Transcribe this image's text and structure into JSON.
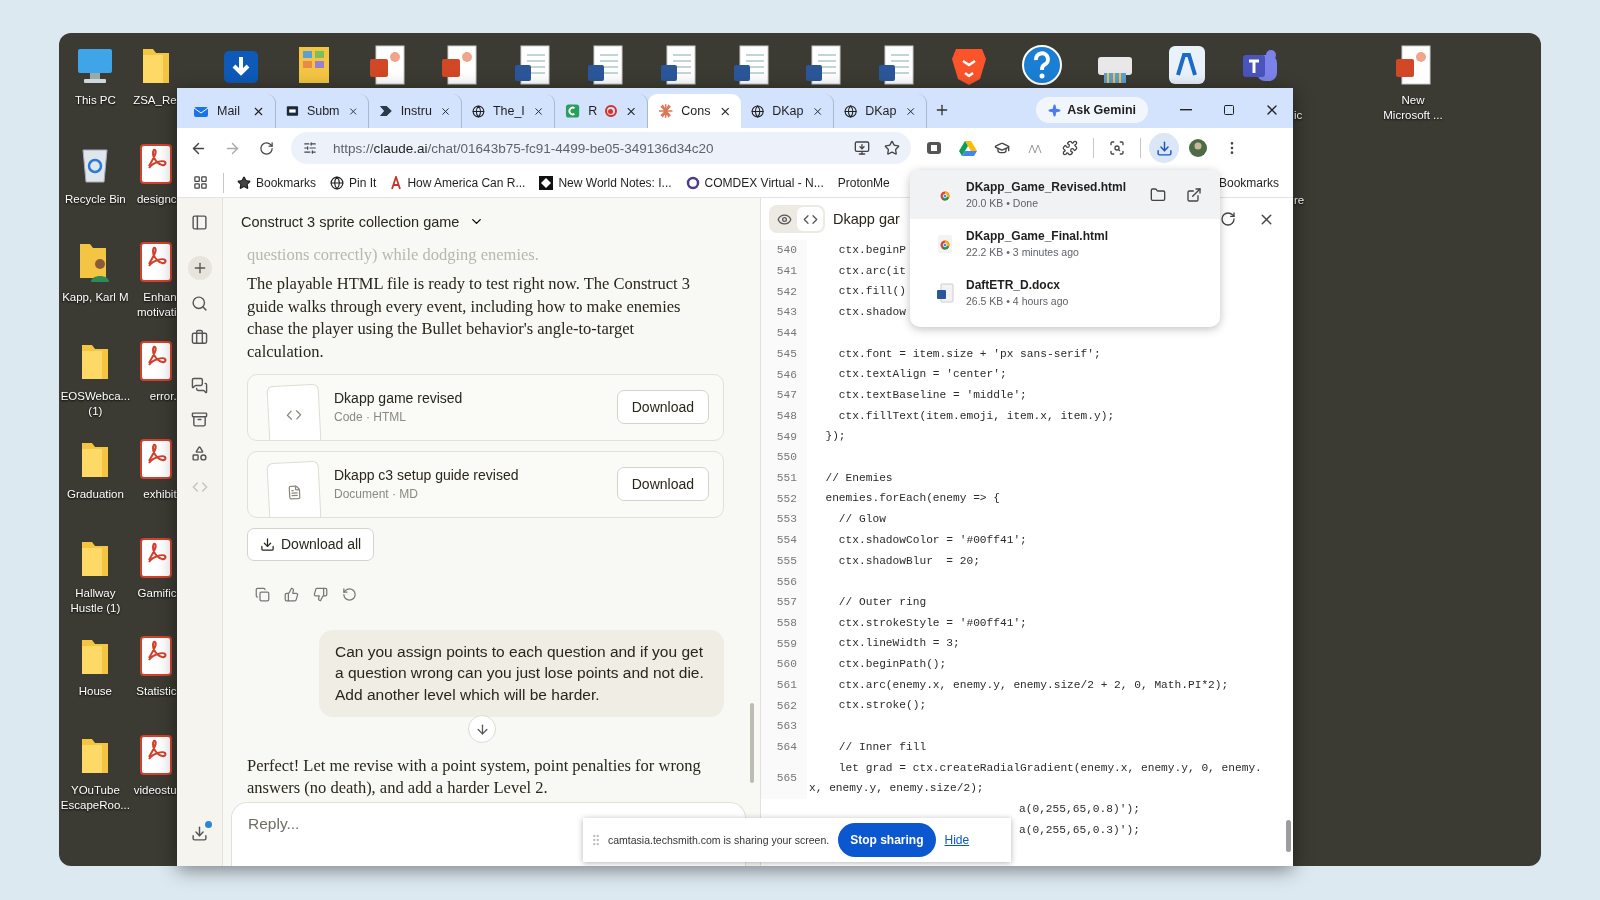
{
  "desktop": {
    "columns": [
      [
        {
          "kind": "pc",
          "label": "This PC"
        },
        {
          "kind": "recycle",
          "label": "Recycle Bin"
        },
        {
          "kind": "person-folder",
          "label": "Kapp, Karl M"
        },
        {
          "kind": "folder",
          "label": "EOSWebca... (1)"
        },
        {
          "kind": "folder",
          "label": "Graduation"
        },
        {
          "kind": "folder",
          "label": "Hallway Hustle (1)"
        },
        {
          "kind": "folder",
          "label": "House"
        },
        {
          "kind": "folder",
          "label": "YOuTube EscapeRoo..."
        }
      ],
      [
        {
          "kind": "folder",
          "label": "ZSA_Re"
        },
        {
          "kind": "pdf",
          "label": "designc"
        },
        {
          "kind": "pdf",
          "label": "Enhan motivati"
        },
        {
          "kind": "pdf",
          "label": "error."
        },
        {
          "kind": "pdf",
          "label": "exhibit"
        },
        {
          "kind": "pdf",
          "label": "Gamific"
        },
        {
          "kind": "pdf",
          "label": "Statistic"
        },
        {
          "kind": "pdf",
          "label": "videostu"
        }
      ],
      [
        {
          "kind": "store"
        }
      ],
      [
        {
          "kind": "photos"
        }
      ],
      [
        {
          "kind": "ppt"
        }
      ],
      [
        {
          "kind": "ppt"
        }
      ],
      [
        {
          "kind": "word"
        }
      ],
      [
        {
          "kind": "word"
        }
      ],
      [
        {
          "kind": "word"
        }
      ],
      [
        {
          "kind": "word"
        }
      ],
      [
        {
          "kind": "word"
        }
      ],
      [
        {
          "kind": "word"
        }
      ],
      [
        {
          "kind": "brave"
        }
      ],
      [
        {
          "kind": "help"
        }
      ],
      [
        {
          "kind": "printer"
        }
      ],
      [
        {
          "kind": "acrobat"
        }
      ],
      [
        {
          "kind": "teams"
        }
      ]
    ],
    "label_fragments": [
      "ic",
      "re"
    ],
    "right_icons": [
      {
        "kind": "ppt",
        "label": "New Microsoft ..."
      }
    ]
  },
  "browser": {
    "tabs": [
      {
        "label": "Mail",
        "kind": "mail",
        "recording": false,
        "selected": false
      },
      {
        "label": "Subm",
        "kind": "sn",
        "recording": false,
        "selected": false
      },
      {
        "label": "Instru",
        "kind": "arrow",
        "recording": false,
        "selected": false
      },
      {
        "label": "The_I",
        "kind": "globe",
        "recording": false,
        "selected": false
      },
      {
        "label": "R",
        "kind": "sheet",
        "recording": true,
        "selected": false
      },
      {
        "label": "Cons",
        "kind": "claude",
        "recording": false,
        "selected": true
      },
      {
        "label": "DKap",
        "kind": "globe",
        "recording": false,
        "selected": false
      },
      {
        "label": "DKap",
        "kind": "globe",
        "recording": false,
        "selected": false
      }
    ],
    "gemini_button": "Ask Gemini",
    "url": {
      "scheme": "https://",
      "host": "claude.ai",
      "path": "/chat/01643b75-fc91-4499-be05-349136d34c20"
    },
    "bookmarks": [
      {
        "label": "Bookmarks",
        "kind": "star"
      },
      {
        "label": "Pin It",
        "kind": "globe"
      },
      {
        "label": "How America Can R...",
        "kind": "letter"
      },
      {
        "label": "New World Notes: I...",
        "kind": "square"
      },
      {
        "label": "COMDEX Virtual - N...",
        "kind": "ring"
      },
      {
        "label": "ProtonMe",
        "kind": "none"
      }
    ],
    "all_bookmarks": "Bookmarks",
    "downloads": [
      {
        "name": "DKapp_Game_Revised.html",
        "meta": "20.0 KB • Done",
        "kind": "web",
        "selected": true
      },
      {
        "name": "DKapp_Game_Final.html",
        "meta": "22.2 KB • 3 minutes ago",
        "kind": "web",
        "selected": false
      },
      {
        "name": "DaftETR_D.docx",
        "meta": "26.5 KB • 4 hours ago",
        "kind": "word",
        "selected": false
      }
    ]
  },
  "chat": {
    "title": "Construct 3 sprite collection game",
    "faded_text": "questions correctly) while dodging enemies.",
    "paragraph": "The playable HTML file is ready to test right now. The Construct 3 guide walks through every event, including how to make enemies chase the player using the Bullet behavior's angle-to-target calculation.",
    "files": [
      {
        "title": "Dkapp game revised",
        "meta": "Code · HTML",
        "kind": "code",
        "button": "Download"
      },
      {
        "title": "Dkapp c3 setup guide revised",
        "meta": "Document · MD",
        "kind": "doc",
        "button": "Download"
      }
    ],
    "download_all": "Download all",
    "user_message": "Can you assign points to each question and if you get a question wrong can you just lose points and not die. Add another level which will be harder.",
    "response": "Perfect! Let me revise with a point system, point penalties for wrong answers (no death), and add a harder Level 2.",
    "reply_placeholder": "Reply..."
  },
  "artifact": {
    "title": "Dkapp gar",
    "view_toggle": [
      {
        "kind": "eye",
        "selected": false
      },
      {
        "kind": "code",
        "selected": true
      }
    ],
    "lines": [
      {
        "kind": "code",
        "number": "540",
        "text": "    ctx.beginP"
      },
      {
        "kind": "code",
        "number": "541",
        "text": "    ctx.arc(it"
      },
      {
        "kind": "code",
        "number": "542",
        "text": "    ctx.fill()"
      },
      {
        "kind": "code",
        "number": "543",
        "text": "    ctx.shadow"
      },
      {
        "kind": "code",
        "number": "544"
      },
      {
        "kind": "code",
        "number": "545",
        "text": "    ctx.font = item.size + 'px sans-serif';"
      },
      {
        "kind": "code",
        "number": "546",
        "text": "    ctx.textAlign = 'center';"
      },
      {
        "kind": "code",
        "number": "547",
        "text": "    ctx.textBaseline = 'middle';"
      },
      {
        "kind": "code",
        "number": "548",
        "text": "    ctx.fillText(item.emoji, item.x, item.y);"
      },
      {
        "kind": "code",
        "number": "549",
        "text": "  });"
      },
      {
        "kind": "code",
        "number": "550"
      },
      {
        "kind": "code",
        "number": "551",
        "text": "  // Enemies"
      },
      {
        "kind": "code",
        "number": "552",
        "text": "  enemies.forEach(enemy => {"
      },
      {
        "kind": "code",
        "number": "553",
        "text": "    // Glow"
      },
      {
        "kind": "code",
        "number": "554",
        "text": "    ctx.shadowColor = '#00ff41';"
      },
      {
        "kind": "code",
        "number": "555",
        "text": "    ctx.shadowBlur  = 20;"
      },
      {
        "kind": "code",
        "number": "556"
      },
      {
        "kind": "code",
        "number": "557",
        "text": "    // Outer ring"
      },
      {
        "kind": "code",
        "number": "558",
        "text": "    ctx.strokeStyle = '#00ff41';"
      },
      {
        "kind": "code",
        "number": "559",
        "text": "    ctx.lineWidth = 3;"
      },
      {
        "kind": "code",
        "number": "560",
        "text": "    ctx.beginPath();"
      },
      {
        "kind": "code",
        "number": "561",
        "text": "    ctx.arc(enemy.x, enemy.y, enemy.size/2 + 2, 0, Math.PI*2);"
      },
      {
        "kind": "code",
        "number": "562",
        "text": "    ctx.stroke();"
      },
      {
        "kind": "code",
        "number": "563"
      },
      {
        "kind": "code",
        "number": "564",
        "text": "    // Inner fill"
      },
      {
        "kind": "code",
        "number": "565",
        "text": "    let grad = ctx.createRadialGradient(enemy.x, enemy.y, 0, enemy.",
        "wrap": "x, enemy.y, enemy.size/2);"
      },
      {
        "kind": "covered",
        "text": "a(0,255,65,0.8)');"
      },
      {
        "kind": "covered",
        "text": "a(0,255,65,0.3)');"
      }
    ]
  },
  "share_bar": {
    "message": "camtasia.techsmith.com is sharing your screen.",
    "stop_button": "Stop sharing",
    "hide_link": "Hide"
  }
}
